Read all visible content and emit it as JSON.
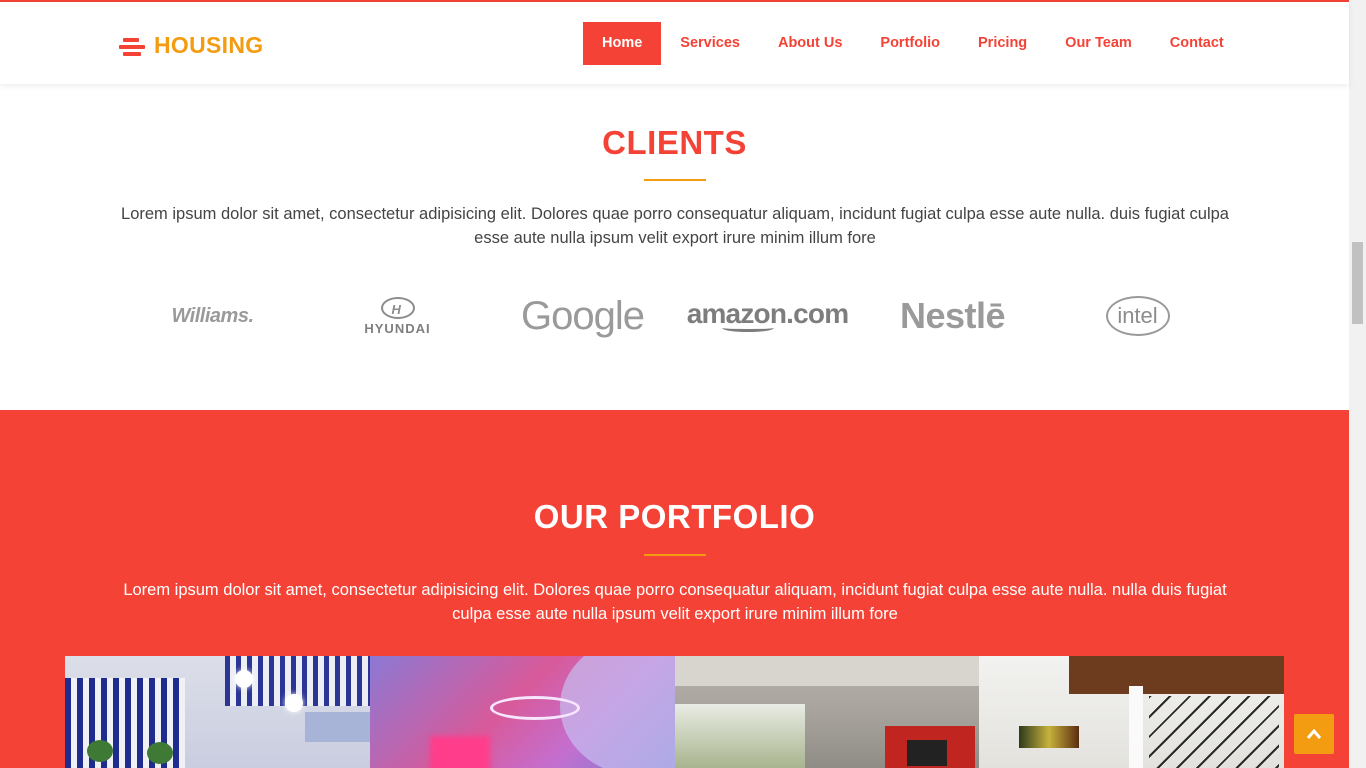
{
  "brand": {
    "name": "HOUSING",
    "logo_icon": "stack-lines-icon",
    "color": "#f39c12"
  },
  "colors": {
    "accent": "#f44336",
    "secondary": "#f39c12"
  },
  "nav": {
    "items": [
      {
        "label": "Home",
        "active": true
      },
      {
        "label": "Services"
      },
      {
        "label": "About Us"
      },
      {
        "label": "Portfolio"
      },
      {
        "label": "Pricing"
      },
      {
        "label": "Our Team"
      },
      {
        "label": "Contact"
      }
    ]
  },
  "clients": {
    "title": "CLIENTS",
    "text": "Lorem ipsum dolor sit amet, consectetur adipisicing elit. Dolores quae porro consequatur aliquam, incidunt fugiat culpa esse aute nulla. duis fugiat culpa esse aute nulla ipsum velit export irure minim illum fore",
    "logos": [
      {
        "name": "Williams",
        "text": "Williams."
      },
      {
        "name": "Hyundai",
        "text": "HYUNDAI",
        "mark": "H"
      },
      {
        "name": "Google",
        "text": "Google"
      },
      {
        "name": "Amazon",
        "text": "amazon.com"
      },
      {
        "name": "Nestle",
        "text": "Nestlē"
      },
      {
        "name": "Intel",
        "text": "intel"
      }
    ]
  },
  "portfolio": {
    "title": "OUR PORTFOLIO",
    "text": "Lorem ipsum dolor sit amet, consectetur adipisicing elit. Dolores quae porro consequatur aliquam, incidunt fugiat culpa esse aute nulla. nulla duis fugiat culpa esse aute nulla ipsum velit export irure minim illum fore",
    "images": [
      "interior-blue-stripes",
      "interior-pink-lounge",
      "interior-living-room",
      "interior-modern-loft"
    ]
  },
  "back_to_top": {
    "icon": "chevron-up-icon"
  }
}
